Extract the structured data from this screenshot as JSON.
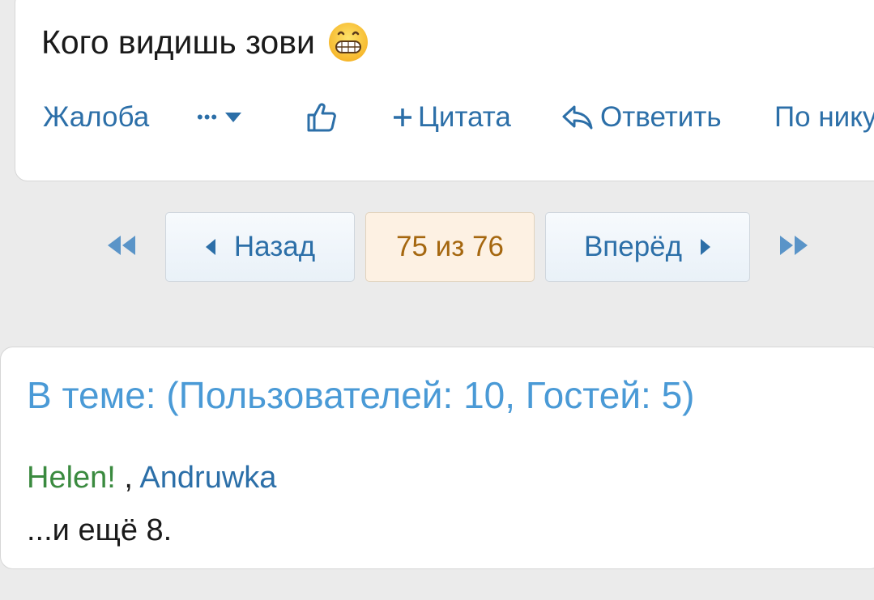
{
  "post": {
    "text": "Кого видишь зови",
    "emoji": "grinning-face-emoji",
    "actions": {
      "report": "Жалоба",
      "more": "•••",
      "quote": "Цитата",
      "reply": "Ответить",
      "by_nick": "По нику"
    }
  },
  "pagination": {
    "prev": "Назад",
    "current": "75 из 76",
    "next": "Вперёд"
  },
  "online": {
    "title": "В теме: (Пользователей: 10, Гостей: 5)",
    "users": [
      "Helen!",
      "Andruwka"
    ],
    "separator": " , ",
    "more": "...и ещё 8."
  },
  "colors": {
    "background": "#ebebeb",
    "link": "#2c6fa8",
    "title": "#4a9ad6",
    "user_green": "#3a8a3f",
    "current_page": "#a5670f"
  }
}
